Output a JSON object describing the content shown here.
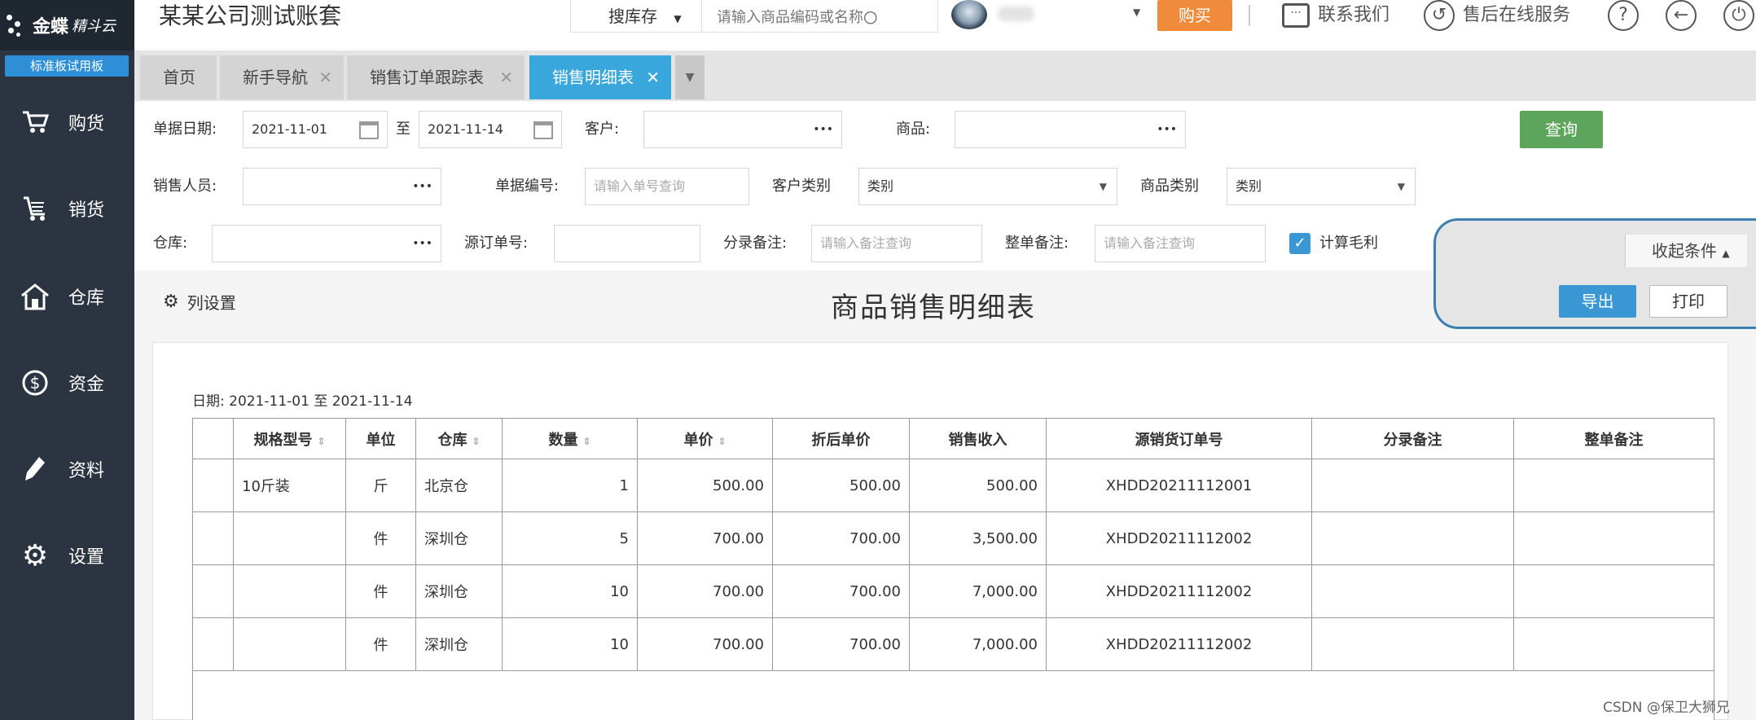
{
  "logo": {
    "name": "金蝶",
    "sub": "精斗云"
  },
  "edition": "标准板试用板",
  "sidebar": {
    "items": [
      {
        "label": "购货",
        "icon": "cart-icon"
      },
      {
        "label": "销货",
        "icon": "sales-cart-icon"
      },
      {
        "label": "仓库",
        "icon": "warehouse-icon"
      },
      {
        "label": "资金",
        "icon": "dollar-icon"
      },
      {
        "label": "资料",
        "icon": "pencil-icon"
      },
      {
        "label": "设置",
        "icon": "gear-icon"
      }
    ]
  },
  "header": {
    "brand": "某某公司测试账套",
    "search_select": "搜库存",
    "search_placeholder": "请输入商品编码或名称",
    "buy": "购买",
    "contact": "联系我们",
    "service": "售后在线服务"
  },
  "tabs": [
    {
      "label": "首页",
      "closable": false
    },
    {
      "label": "新手导航",
      "closable": true
    },
    {
      "label": "销售订单跟踪表",
      "closable": true
    },
    {
      "label": "销售明细表",
      "closable": true,
      "active": true
    }
  ],
  "filters": {
    "date_label": "单据日期:",
    "date_from": "2021-11-01",
    "to_label": "至",
    "date_to": "2021-11-14",
    "customer_label": "客户:",
    "product_label": "商品:",
    "query": "查询",
    "sales_person_label": "销售人员:",
    "doc_no_label": "单据编号:",
    "doc_no_placeholder": "请输入单号查询",
    "customer_type_label": "客户类别",
    "customer_type_value": "类别",
    "product_type_label": "商品类别",
    "product_type_value": "类别",
    "warehouse_label": "仓库:",
    "source_no_label": "源订单号:",
    "entry_note_label": "分录备注:",
    "entry_note_placeholder": "请输入备注查询",
    "order_note_label": "整单备注:",
    "order_note_placeholder": "请输入备注查询",
    "gross_profit_label": "计算毛利",
    "gross_profit_checked": true
  },
  "actions": {
    "collapse": "收起条件",
    "export": "导出",
    "print": "打印"
  },
  "report": {
    "col_settings": "列设置",
    "title": "商品销售明细表",
    "date_range": "日期: 2021-11-01 至 2021-11-14",
    "columns": [
      "",
      "规格型号",
      "单位",
      "仓库",
      "数量",
      "单价",
      "折后单价",
      "销售收入",
      "源销货订单号",
      "分录备注",
      "整单备注"
    ],
    "rows": [
      [
        "",
        "10斤装",
        "斤",
        "北京仓",
        "1",
        "500.00",
        "500.00",
        "500.00",
        "XHDD20211112001",
        "",
        ""
      ],
      [
        "",
        "",
        "件",
        "深圳仓",
        "5",
        "700.00",
        "700.00",
        "3,500.00",
        "XHDD20211112002",
        "",
        ""
      ],
      [
        "",
        "",
        "件",
        "深圳仓",
        "10",
        "700.00",
        "700.00",
        "7,000.00",
        "XHDD20211112002",
        "",
        ""
      ],
      [
        "",
        "",
        "件",
        "深圳仓",
        "10",
        "700.00",
        "700.00",
        "7,000.00",
        "XHDD20211112002",
        "",
        ""
      ]
    ]
  },
  "watermark": "CSDN @保卫大狮兄",
  "colors": {
    "sidebar": "#2b3440",
    "accent": "#3aa7dc",
    "buy": "#f08b3c",
    "query": "#5da55d"
  }
}
